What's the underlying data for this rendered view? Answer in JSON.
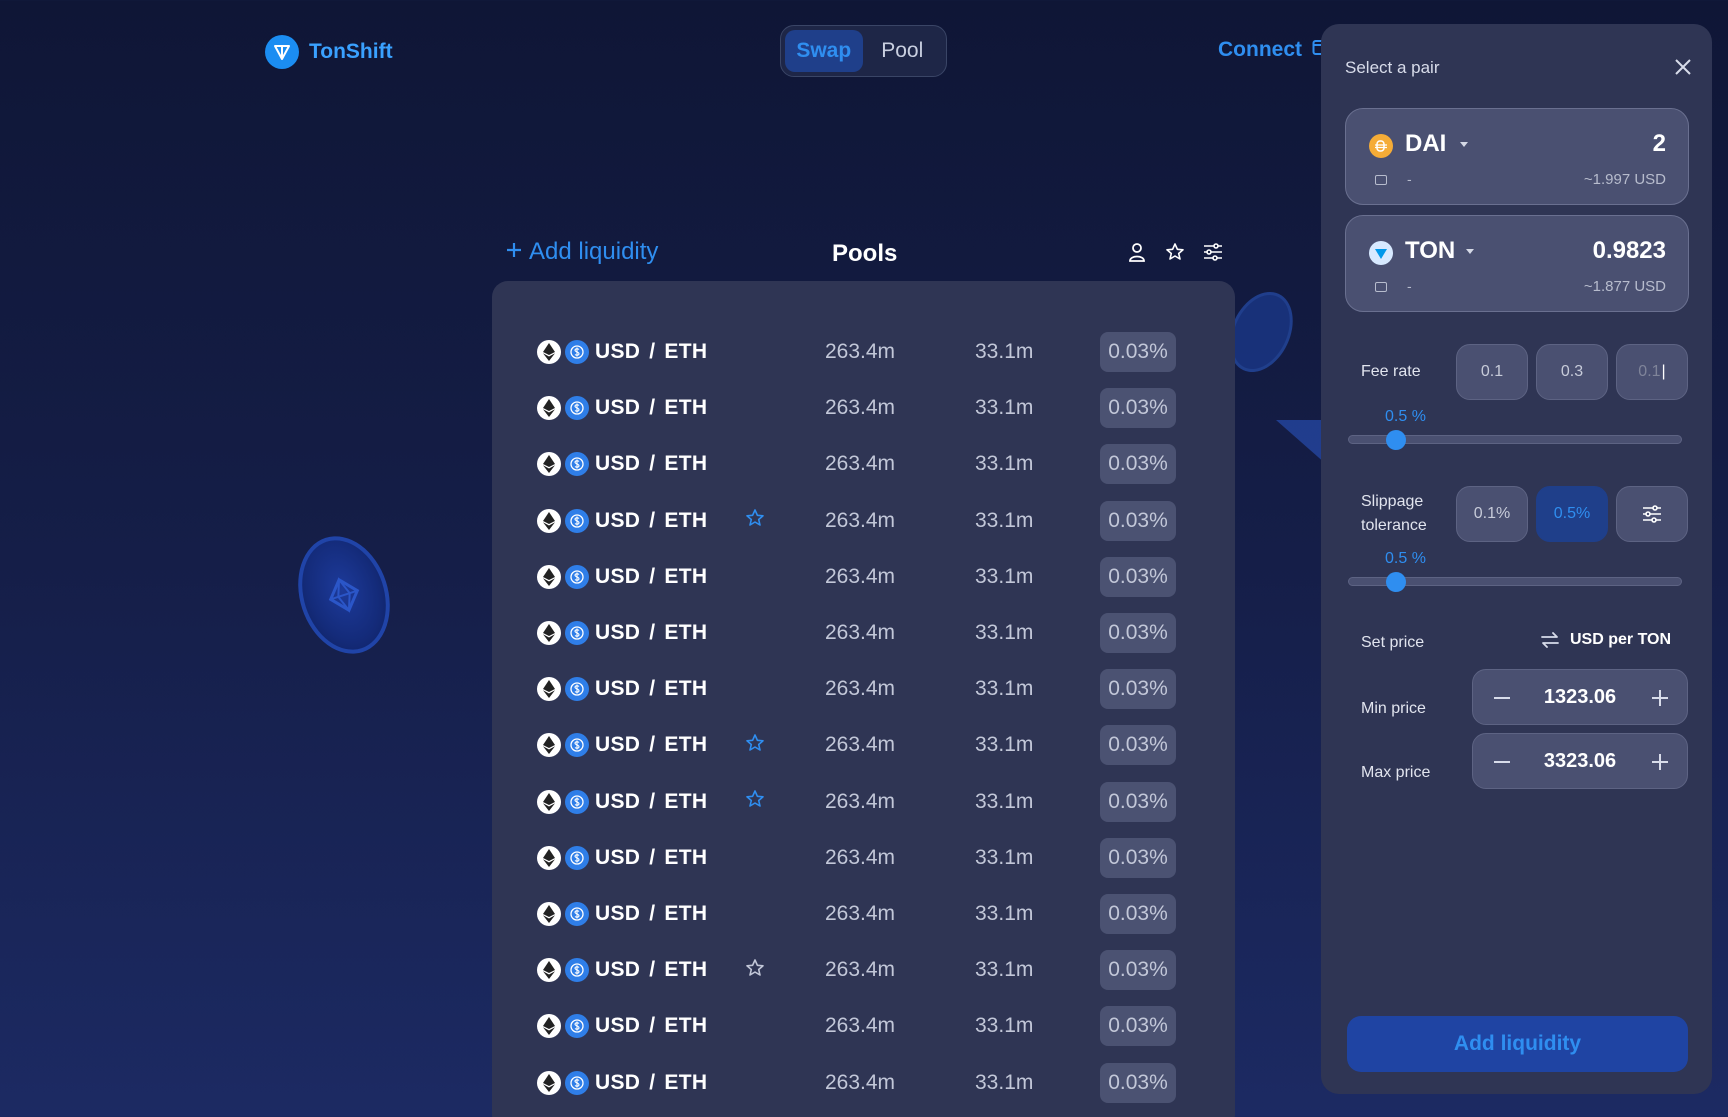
{
  "header": {
    "logo_text": "TonShift",
    "nav": [
      {
        "label": "Swap",
        "active": true
      },
      {
        "label": "Pool",
        "active": false
      }
    ],
    "connect_label": "Connect"
  },
  "pools": {
    "add_liquidity_label": "Add liquidity",
    "title": "Pools",
    "rows": [
      {
        "pair_base": "USD",
        "sep": "/",
        "pair_quote": "ETH",
        "starred": false,
        "tvl": "263.4m",
        "volume": "33.1m",
        "fee": "0.03%"
      },
      {
        "pair_base": "USD",
        "sep": "/",
        "pair_quote": "ETH",
        "starred": false,
        "tvl": "263.4m",
        "volume": "33.1m",
        "fee": "0.03%"
      },
      {
        "pair_base": "USD",
        "sep": "/",
        "pair_quote": "ETH",
        "starred": false,
        "tvl": "263.4m",
        "volume": "33.1m",
        "fee": "0.03%"
      },
      {
        "pair_base": "USD",
        "sep": "/",
        "pair_quote": "ETH",
        "starred": "blue",
        "tvl": "263.4m",
        "volume": "33.1m",
        "fee": "0.03%"
      },
      {
        "pair_base": "USD",
        "sep": "/",
        "pair_quote": "ETH",
        "starred": false,
        "tvl": "263.4m",
        "volume": "33.1m",
        "fee": "0.03%"
      },
      {
        "pair_base": "USD",
        "sep": "/",
        "pair_quote": "ETH",
        "starred": false,
        "tvl": "263.4m",
        "volume": "33.1m",
        "fee": "0.03%"
      },
      {
        "pair_base": "USD",
        "sep": "/",
        "pair_quote": "ETH",
        "starred": false,
        "tvl": "263.4m",
        "volume": "33.1m",
        "fee": "0.03%"
      },
      {
        "pair_base": "USD",
        "sep": "/",
        "pair_quote": "ETH",
        "starred": "blue",
        "tvl": "263.4m",
        "volume": "33.1m",
        "fee": "0.03%"
      },
      {
        "pair_base": "USD",
        "sep": "/",
        "pair_quote": "ETH",
        "starred": "blue",
        "tvl": "263.4m",
        "volume": "33.1m",
        "fee": "0.03%"
      },
      {
        "pair_base": "USD",
        "sep": "/",
        "pair_quote": "ETH",
        "starred": false,
        "tvl": "263.4m",
        "volume": "33.1m",
        "fee": "0.03%"
      },
      {
        "pair_base": "USD",
        "sep": "/",
        "pair_quote": "ETH",
        "starred": false,
        "tvl": "263.4m",
        "volume": "33.1m",
        "fee": "0.03%"
      },
      {
        "pair_base": "USD",
        "sep": "/",
        "pair_quote": "ETH",
        "starred": "grey",
        "tvl": "263.4m",
        "volume": "33.1m",
        "fee": "0.03%"
      },
      {
        "pair_base": "USD",
        "sep": "/",
        "pair_quote": "ETH",
        "starred": false,
        "tvl": "263.4m",
        "volume": "33.1m",
        "fee": "0.03%"
      },
      {
        "pair_base": "USD",
        "sep": "/",
        "pair_quote": "ETH",
        "starred": false,
        "tvl": "263.4m",
        "volume": "33.1m",
        "fee": "0.03%"
      }
    ]
  },
  "drawer": {
    "title": "Select a pair",
    "token_a": {
      "symbol": "DAI",
      "amount": "2",
      "balance": "-",
      "usd": "~1.997 USD",
      "icon": "dai-icon",
      "color": "#f5ac37"
    },
    "token_b": {
      "symbol": "TON",
      "amount": "0.9823",
      "balance": "-",
      "usd": "~1.877 USD",
      "icon": "ton-icon",
      "color": "#0098ea"
    },
    "fee_rate": {
      "label": "Fee rate",
      "options": [
        "0.1",
        "0.3"
      ],
      "input_placeholder": "0.1",
      "slider_label": "0.5 %",
      "slider_fraction": 0.14
    },
    "slippage": {
      "label_line1": "Slippage",
      "label_line2": "tolerance",
      "options": [
        "0.1%",
        "0.5%"
      ],
      "selected": "0.5%",
      "slider_label": "0.5 %",
      "slider_fraction": 0.14
    },
    "price": {
      "set_label": "Set price",
      "unit": "USD per TON",
      "min_label": "Min price",
      "min_value": "1323.06",
      "max_label": "Max price",
      "max_value": "3323.06"
    },
    "submit_label": "Add liquidity"
  },
  "colors": {
    "accent": "#2f8ef0",
    "panel": "#2f3554",
    "background": "#121a3f"
  }
}
